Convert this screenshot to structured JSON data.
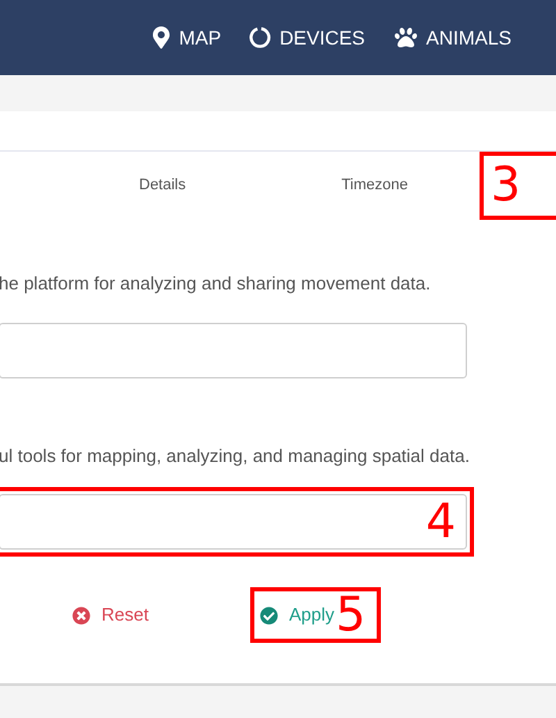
{
  "nav": {
    "items": [
      {
        "kind": "pin",
        "label": "MAP"
      },
      {
        "kind": "ring",
        "label": "DEVICES"
      },
      {
        "kind": "paw",
        "label": "ANIMALS"
      }
    ]
  },
  "tabs": [
    {
      "label": "Details",
      "selected": false
    },
    {
      "label": "Timezone",
      "selected": false
    }
  ],
  "tab_marker": "3",
  "fields": [
    {
      "description": "he platform for analyzing and sharing movement data."
    },
    {
      "description": "ul tools for mapping, analyzing, and managing spatial data.",
      "marker": "4"
    }
  ],
  "actions": [
    {
      "kind": "reset",
      "label": "Reset"
    },
    {
      "kind": "apply",
      "label": "Apply",
      "marker": "5"
    }
  ]
}
